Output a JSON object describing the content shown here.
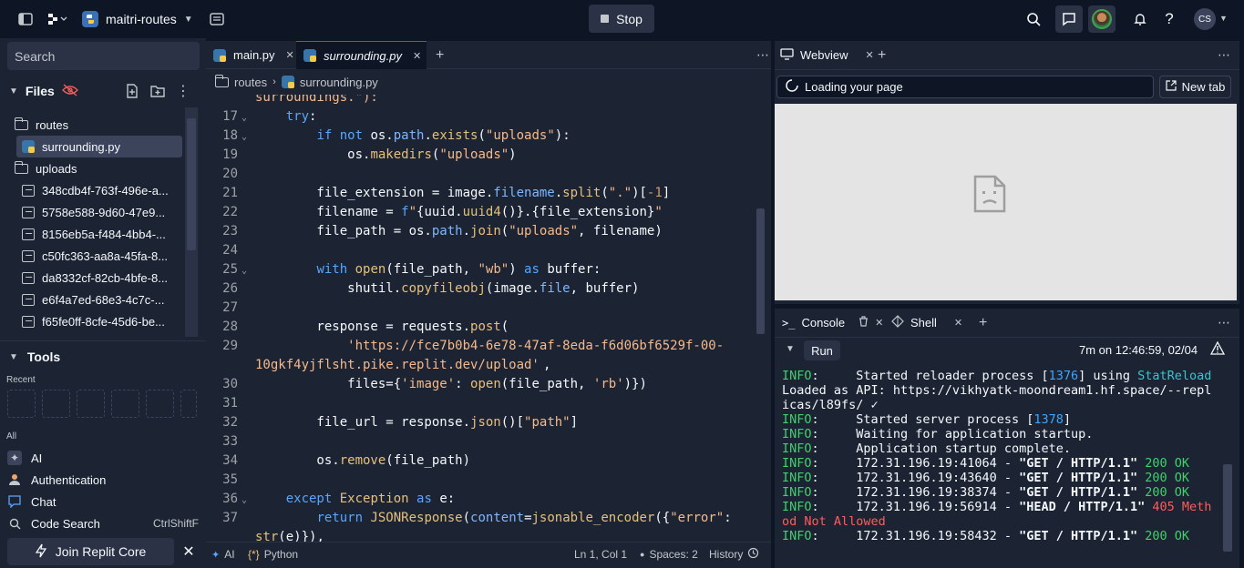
{
  "topbar": {
    "repl_name": "maitri-routes",
    "stop_label": "Stop",
    "user_initials": "CS"
  },
  "sidebar": {
    "search_placeholder": "Search",
    "files_header": "Files",
    "tree": [
      {
        "name": "routes",
        "type": "folder"
      },
      {
        "name": "surrounding.py",
        "type": "python",
        "selected": true
      },
      {
        "name": "uploads",
        "type": "folder"
      },
      {
        "name": "348cdb4f-763f-496e-a...",
        "type": "image"
      },
      {
        "name": "5758e588-9d60-47e9...",
        "type": "image"
      },
      {
        "name": "8156eb5a-f484-4bb4-...",
        "type": "image"
      },
      {
        "name": "c50fc363-aa8a-45fa-8...",
        "type": "image"
      },
      {
        "name": "da8332cf-82cb-4bfe-8...",
        "type": "image"
      },
      {
        "name": "e6f4a7ed-68e3-4c7c-...",
        "type": "image"
      },
      {
        "name": "f65fe0ff-8cfe-45d6-be...",
        "type": "image"
      }
    ],
    "tools_header": "Tools",
    "recent_label": "Recent",
    "all_label": "All",
    "tools": [
      {
        "label": "AI",
        "shortcut": ""
      },
      {
        "label": "Authentication",
        "shortcut": ""
      },
      {
        "label": "Chat",
        "shortcut": ""
      },
      {
        "label": "Code Search",
        "shortcut": "CtrlShiftF"
      }
    ],
    "join_label": "Join Replit Core"
  },
  "editor": {
    "tabs": [
      {
        "label": "main.py",
        "active": false
      },
      {
        "label": "surrounding.py",
        "active": true
      }
    ],
    "breadcrumb": [
      "routes",
      "surrounding.py"
    ],
    "partial_top": "surroundings.\"):",
    "lines": [
      {
        "n": "17",
        "text": "    try:"
      },
      {
        "n": "18",
        "text": "        if not os.path.exists(\"uploads\"):"
      },
      {
        "n": "19",
        "text": "            os.makedirs(\"uploads\")"
      },
      {
        "n": "20",
        "text": ""
      },
      {
        "n": "21",
        "text": "        file_extension = image.filename.split(\".\")[-1]"
      },
      {
        "n": "22",
        "text": "        filename = f\"{uuid.uuid4()}.{file_extension}\""
      },
      {
        "n": "23",
        "text": "        file_path = os.path.join(\"uploads\", filename)"
      },
      {
        "n": "24",
        "text": ""
      },
      {
        "n": "25",
        "text": "        with open(file_path, \"wb\") as buffer:"
      },
      {
        "n": "26",
        "text": "            shutil.copyfileobj(image.file, buffer)"
      },
      {
        "n": "27",
        "text": ""
      },
      {
        "n": "28",
        "text": "        response = requests.post("
      },
      {
        "n": "29",
        "text": "            'https://fce7b0b4-6e78-47af-8eda-f6d06bf6529f-00-"
      },
      {
        "n": "",
        "text": "10gkf4yjflsht.pike.replit.dev/upload',"
      },
      {
        "n": "30",
        "text": "            files={'image': open(file_path, 'rb')})"
      },
      {
        "n": "31",
        "text": ""
      },
      {
        "n": "32",
        "text": "        file_url = response.json()[\"path\"]"
      },
      {
        "n": "33",
        "text": ""
      },
      {
        "n": "34",
        "text": "        os.remove(file_path)"
      },
      {
        "n": "35",
        "text": ""
      },
      {
        "n": "36",
        "text": "    except Exception as e:"
      },
      {
        "n": "37",
        "text": "        return JSONResponse(content=jsonable_encoder({\"error\":"
      },
      {
        "n": "",
        "text": "str(e)}),"
      }
    ],
    "status": {
      "ai": "AI",
      "language": "Python",
      "position": "Ln 1, Col 1",
      "spaces": "Spaces: 2",
      "history": "History"
    }
  },
  "webview": {
    "tab_label": "Webview",
    "url_text": "Loading your page",
    "new_tab_label": "New tab"
  },
  "console": {
    "tabs": [
      "Console",
      "Shell"
    ],
    "run_label": "Run",
    "timestamp": "7m on 12:46:59, 02/04",
    "lines": [
      "INFO:     Started reloader process [1376] using StatReload",
      "Loaded as API: https://vikhyatk-moondream1.hf.space/--repl",
      "icas/l89fs/ ✓",
      "INFO:     Started server process [1378]",
      "INFO:     Waiting for application startup.",
      "INFO:     Application startup complete.",
      "INFO:     172.31.196.19:41064 - \"GET / HTTP/1.1\" 200 OK",
      "INFO:     172.31.196.19:43640 - \"GET / HTTP/1.1\" 200 OK",
      "INFO:     172.31.196.19:38374 - \"GET / HTTP/1.1\" 200 OK",
      "INFO:     172.31.196.19:56914 - \"HEAD / HTTP/1.1\" 405 Meth",
      "od Not Allowed",
      "INFO:     172.31.196.19:58432 - \"GET / HTTP/1.1\" 200 OK"
    ]
  },
  "colors": {
    "bg": "#0e1525",
    "panel": "#1c2333",
    "accent": "#0079f2",
    "ok_green": "#3fd16b",
    "error_red": "#ff5c5c"
  }
}
